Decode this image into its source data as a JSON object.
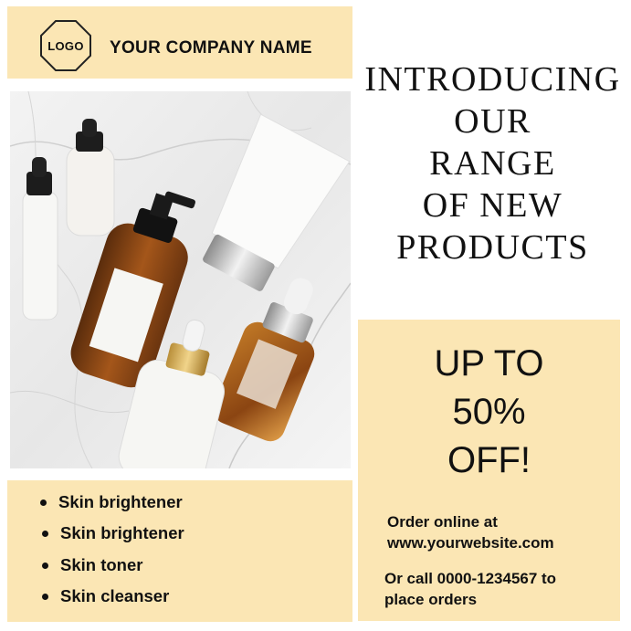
{
  "header": {
    "logo_text": "LOGO",
    "company_name": "YOUR COMPANY NAME"
  },
  "headline": {
    "lines": [
      "INTRODUCING",
      "OUR",
      "RANGE",
      "OF NEW",
      "PRODUCTS"
    ]
  },
  "photo": {
    "subject": "skincare bottles and tubes on marble"
  },
  "features": [
    "Skin brightener",
    "Skin brightener",
    "Skin toner",
    "Skin cleanser"
  ],
  "offer": {
    "lines": [
      "UP TO",
      "50%",
      "OFF!"
    ]
  },
  "contact": {
    "online_lines": [
      "Order online at",
      "www.yourwebsite.com"
    ],
    "call_lines": [
      "Or call 0000-1234567 to",
      "place orders"
    ]
  },
  "colors": {
    "panel": "#fbe6b4",
    "text": "#111111",
    "background": "#ffffff"
  }
}
